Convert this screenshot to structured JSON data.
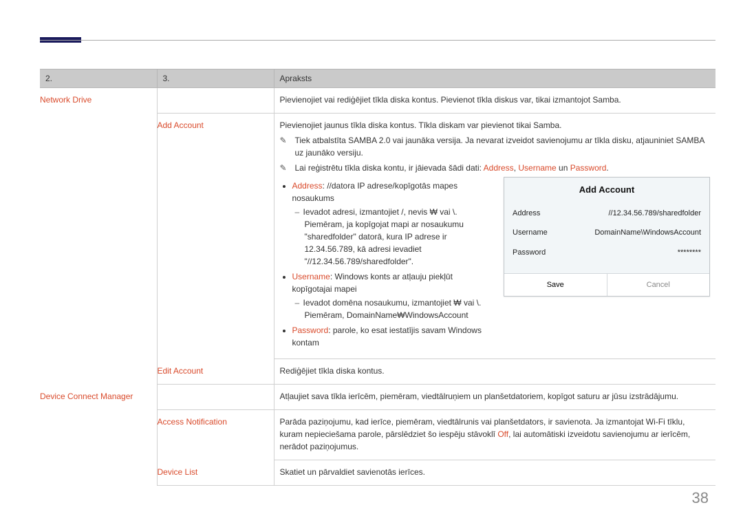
{
  "header": {
    "col1": "2.",
    "col2": "3.",
    "col3": "Apraksts"
  },
  "rows": {
    "network_drive": {
      "label": "Network Drive",
      "desc": "Pievienojiet vai rediģējiet tīkla diska kontus. Pievienot tīkla diskus var, tikai izmantojot Samba."
    },
    "add_account": {
      "label": "Add Account",
      "desc": "Pievienojiet jaunus tīkla diska kontus. Tīkla diskam var pievienot tikai Samba.",
      "note1": "Tiek atbalstīta SAMBA 2.0 vai jaunāka versija. Ja nevarat izveidot savienojumu ar tīkla disku, atjauniniet SAMBA uz jaunāko versiju.",
      "note2_pre": "Lai reģistrētu tīkla diska kontu, ir jāievada šādi dati: ",
      "note2_addr": "Address",
      "note2_sep1": ", ",
      "note2_user": "Username",
      "note2_un": " un ",
      "note2_pwd": "Password",
      "note2_post": ".",
      "addr_label": "Address",
      "addr_after": ": //datora IP adrese/kopīgotās mapes nosaukums",
      "addr_sub1": "Ievadot adresi, izmantojiet /, nevis ₩ vai \\.",
      "addr_sub2": "Piemēram, ja kopīgojat mapi ar nosaukumu \"sharedfolder\" datorā, kura IP adrese ir 12.34.56.789, kā adresi ievadiet \"//12.34.56.789/sharedfolder\".",
      "user_label": "Username",
      "user_after": ": Windows konts ar atļauju piekļūt kopīgotajai mapei",
      "user_sub1": "Ievadot domēna nosaukumu, izmantojiet ₩ vai \\.",
      "user_sub2": "Piemēram, DomainName₩WindowsAccount",
      "pwd_label": "Password",
      "pwd_after": ": parole, ko esat iestatījis savam Windows kontam"
    },
    "edit_account": {
      "label": "Edit Account",
      "desc": "Rediģējiet tīkla diska kontus."
    },
    "device_connect_manager": {
      "label": "Device Connect Manager",
      "desc": "Atļaujiet sava tīkla ierīcēm, piemēram, viedtālruņiem un planšetdatoriem, kopīgot saturu ar jūsu izstrādājumu."
    },
    "access_notification": {
      "label": "Access Notification",
      "desc_pre": "Parāda paziņojumu, kad ierīce, piemēram, viedtālrunis vai planšetdators, ir savienota. Ja izmantojat Wi-Fi tīklu, kuram nepieciešama parole, pārslēdziet šo iespēju stāvoklī ",
      "off": "Off",
      "desc_post": ", lai automātiski izveidotu savienojumu ar ierīcēm, nerādot paziņojumus."
    },
    "device_list": {
      "label": "Device List",
      "desc": "Skatiet un pārvaldiet savienotās ierīces."
    }
  },
  "dialog": {
    "title": "Add Account",
    "address": {
      "label": "Address",
      "value": "//12.34.56.789/sharedfolder"
    },
    "username": {
      "label": "Username",
      "value": "DomainName\\WindowsAccount"
    },
    "password": {
      "label": "Password",
      "value": "********"
    },
    "save": "Save",
    "cancel": "Cancel"
  },
  "page_number": "38"
}
